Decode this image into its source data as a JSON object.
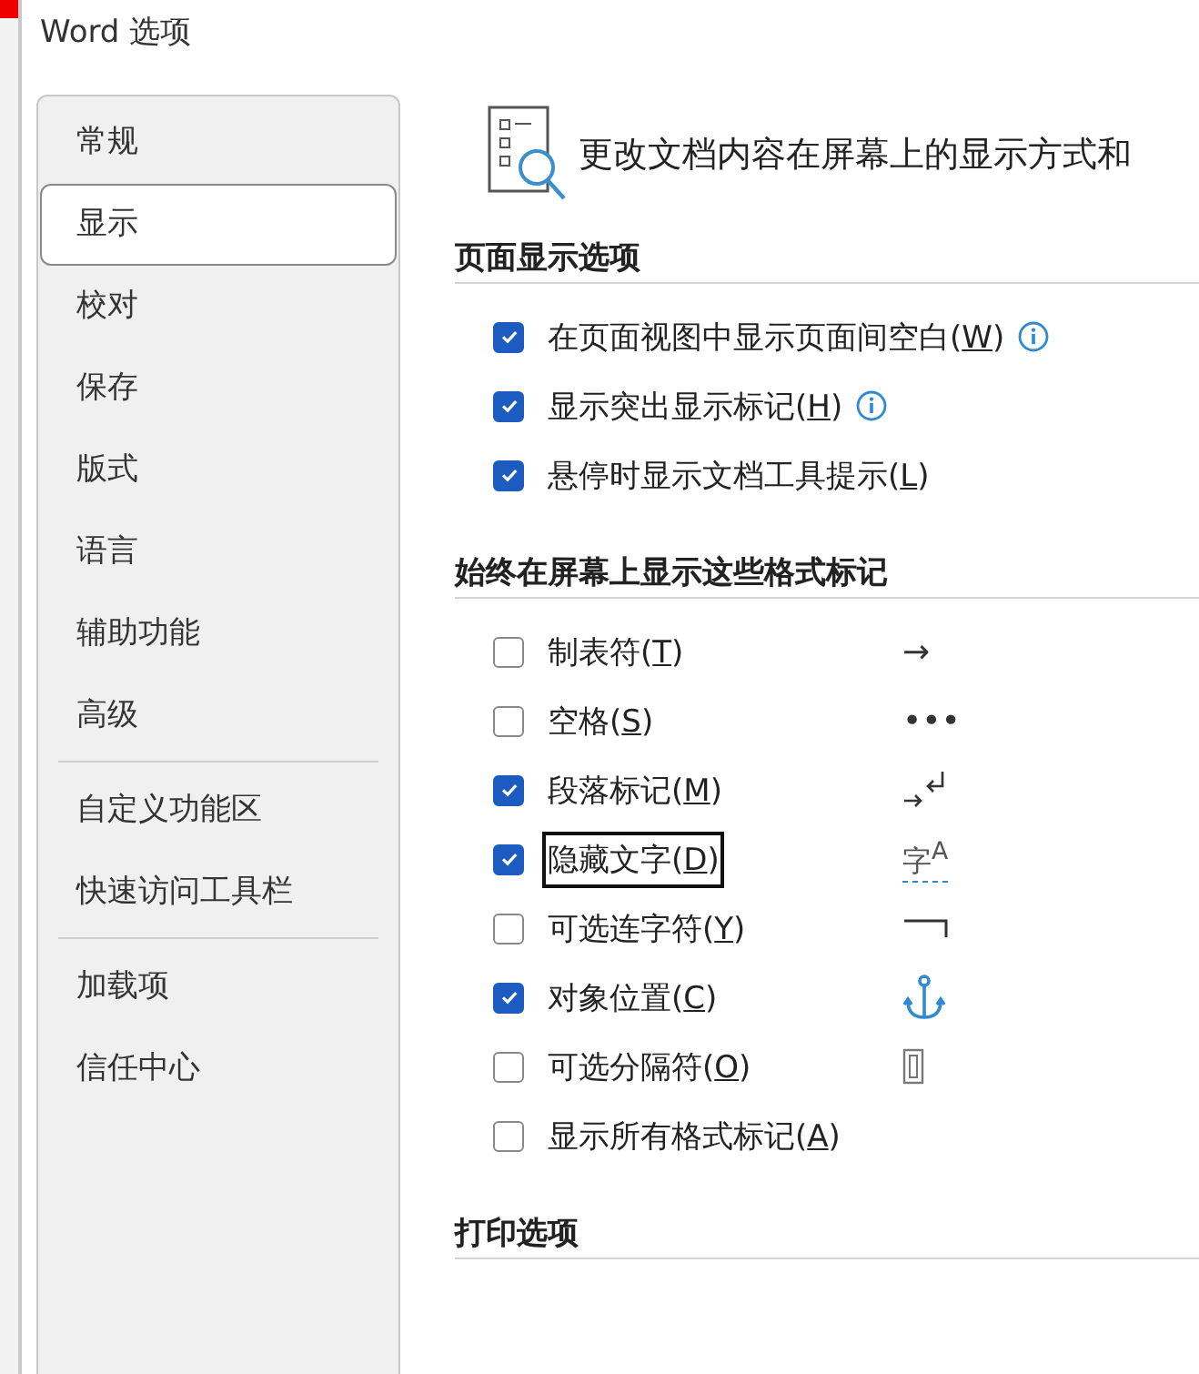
{
  "window": {
    "title": "Word 选项"
  },
  "sidebar": {
    "groups": [
      [
        {
          "label": "常规",
          "selected": false
        },
        {
          "label": "显示",
          "selected": true
        },
        {
          "label": "校对",
          "selected": false
        },
        {
          "label": "保存",
          "selected": false
        },
        {
          "label": "版式",
          "selected": false
        },
        {
          "label": "语言",
          "selected": false
        },
        {
          "label": "辅助功能",
          "selected": false
        },
        {
          "label": "高级",
          "selected": false
        }
      ],
      [
        {
          "label": "自定义功能区",
          "selected": false
        },
        {
          "label": "快速访问工具栏",
          "selected": false
        }
      ],
      [
        {
          "label": "加载项",
          "selected": false
        },
        {
          "label": "信任中心",
          "selected": false
        }
      ]
    ]
  },
  "header": {
    "text": "更改文档内容在屏幕上的显示方式和"
  },
  "sections": [
    {
      "title": "页面显示选项",
      "options": [
        {
          "before": "在页面视图中显示页面间空白(",
          "key": "W",
          "after": ")",
          "checked": true,
          "info": true,
          "focused": false
        },
        {
          "before": "显示突出显示标记(",
          "key": "H",
          "after": ")",
          "checked": true,
          "info": true,
          "focused": false
        },
        {
          "before": "悬停时显示文档工具提示(",
          "key": "L",
          "after": ")",
          "checked": true,
          "info": false,
          "focused": false
        }
      ]
    },
    {
      "title": "始终在屏幕上显示这些格式标记",
      "options": [
        {
          "before": "制表符(",
          "key": "T",
          "after": ")",
          "checked": false,
          "info": false,
          "focused": false,
          "mark": {
            "kind": "text",
            "text": "→"
          }
        },
        {
          "before": "空格(",
          "key": "S",
          "after": ")",
          "checked": false,
          "info": false,
          "focused": false,
          "mark": {
            "kind": "text",
            "text": "•••"
          }
        },
        {
          "before": "段落标记(",
          "key": "M",
          "after": ")",
          "checked": true,
          "info": false,
          "focused": false,
          "mark": {
            "kind": "paragraph"
          }
        },
        {
          "before": "隐藏文字(",
          "key": "D",
          "after": ")",
          "checked": true,
          "info": false,
          "focused": true,
          "mark": {
            "kind": "hidden",
            "text": "字$^{A}$"
          }
        },
        {
          "before": "可选连字符(",
          "key": "Y",
          "after": ")",
          "checked": false,
          "info": false,
          "focused": false,
          "mark": {
            "kind": "hyphen"
          }
        },
        {
          "before": "对象位置(",
          "key": "C",
          "after": ")",
          "checked": true,
          "info": false,
          "focused": false,
          "mark": {
            "kind": "anchor"
          }
        },
        {
          "before": "可选分隔符(",
          "key": "O",
          "after": ")",
          "checked": false,
          "info": false,
          "focused": false,
          "mark": {
            "kind": "break"
          }
        },
        {
          "before": "显示所有格式标记(",
          "key": "A",
          "after": ")",
          "checked": false,
          "info": false,
          "focused": false
        }
      ]
    },
    {
      "title": "打印选项"
    }
  ]
}
